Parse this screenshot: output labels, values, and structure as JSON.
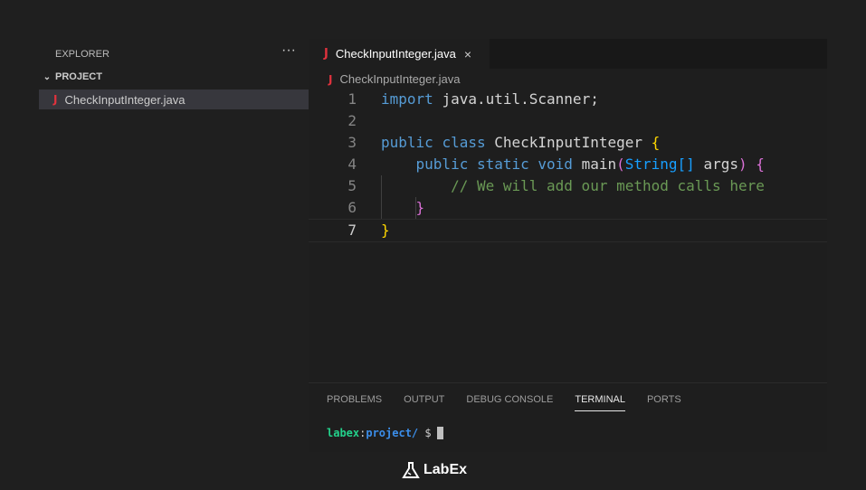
{
  "sidebar": {
    "title": "EXPLORER",
    "more": "···",
    "project": "PROJECT",
    "chevron": "⌄",
    "file": "CheckInputInteger.java"
  },
  "editor": {
    "tab_label": "CheckInputInteger.java",
    "close": "×",
    "breadcrumb": "CheckInputInteger.java",
    "java_icon": "J",
    "lines": [
      {
        "n": "1",
        "parts": [
          [
            "kw",
            "import"
          ],
          [
            "",
            "java.util.Scanner;"
          ]
        ]
      },
      {
        "n": "2",
        "parts": []
      },
      {
        "n": "3",
        "parts": [
          [
            "kw",
            "public"
          ],
          [
            "kw",
            "class"
          ],
          [
            "",
            "CheckInputInteger"
          ],
          [
            "y",
            "{"
          ]
        ]
      },
      {
        "n": "4",
        "parts": [
          [
            "kw",
            "    public"
          ],
          [
            "kw",
            "static"
          ],
          [
            "kw",
            "void"
          ],
          [
            "",
            "main"
          ],
          [
            "p",
            "("
          ],
          [
            "b",
            "String[]"
          ],
          [
            "",
            "args"
          ],
          [
            "p",
            ")"
          ],
          [
            "p",
            "{"
          ]
        ]
      },
      {
        "n": "5",
        "parts": [
          [
            "cm",
            "        // We will add our method calls here"
          ]
        ]
      },
      {
        "n": "6",
        "parts": [
          [
            "p",
            "    }"
          ]
        ]
      },
      {
        "n": "7",
        "parts": [
          [
            "y",
            "}"
          ]
        ]
      }
    ]
  },
  "panel": {
    "tabs": [
      "PROBLEMS",
      "OUTPUT",
      "DEBUG CONSOLE",
      "TERMINAL",
      "PORTS"
    ],
    "active": "TERMINAL",
    "terminal": {
      "user": "labex",
      "sep": ":",
      "path": "project/",
      "prompt": " $"
    }
  },
  "brand": {
    "logo_text": "LabEx"
  }
}
